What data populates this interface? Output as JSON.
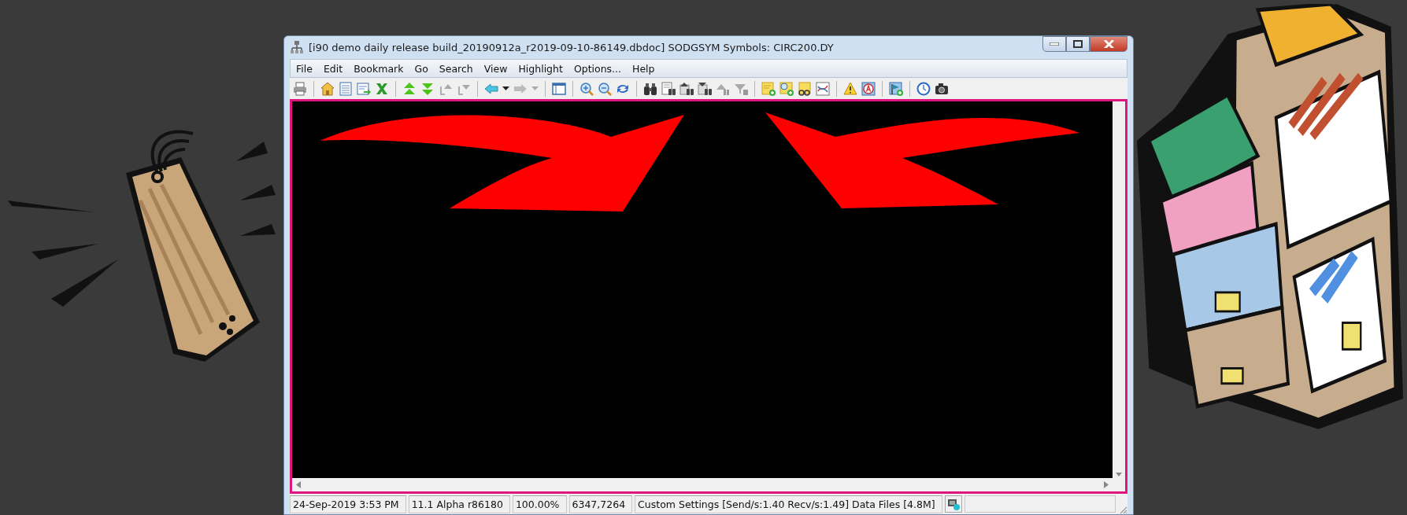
{
  "window": {
    "title": "[i90 demo daily release build_20190912a_r2019-09-10-86149.dbdoc] SODGSYM Symbols: CIRC200.DY"
  },
  "menu": [
    "File",
    "Edit",
    "Bookmark",
    "Go",
    "Search",
    "View",
    "Highlight",
    "Options...",
    "Help"
  ],
  "status_bar": [
    "24-Sep-2019 3:53 PM",
    "11.1 Alpha r86180",
    "100.00%",
    "6347,7264",
    "Custom Settings [Send/s:1.40 Recv/s:1.49] Data Files [4.8M]"
  ]
}
